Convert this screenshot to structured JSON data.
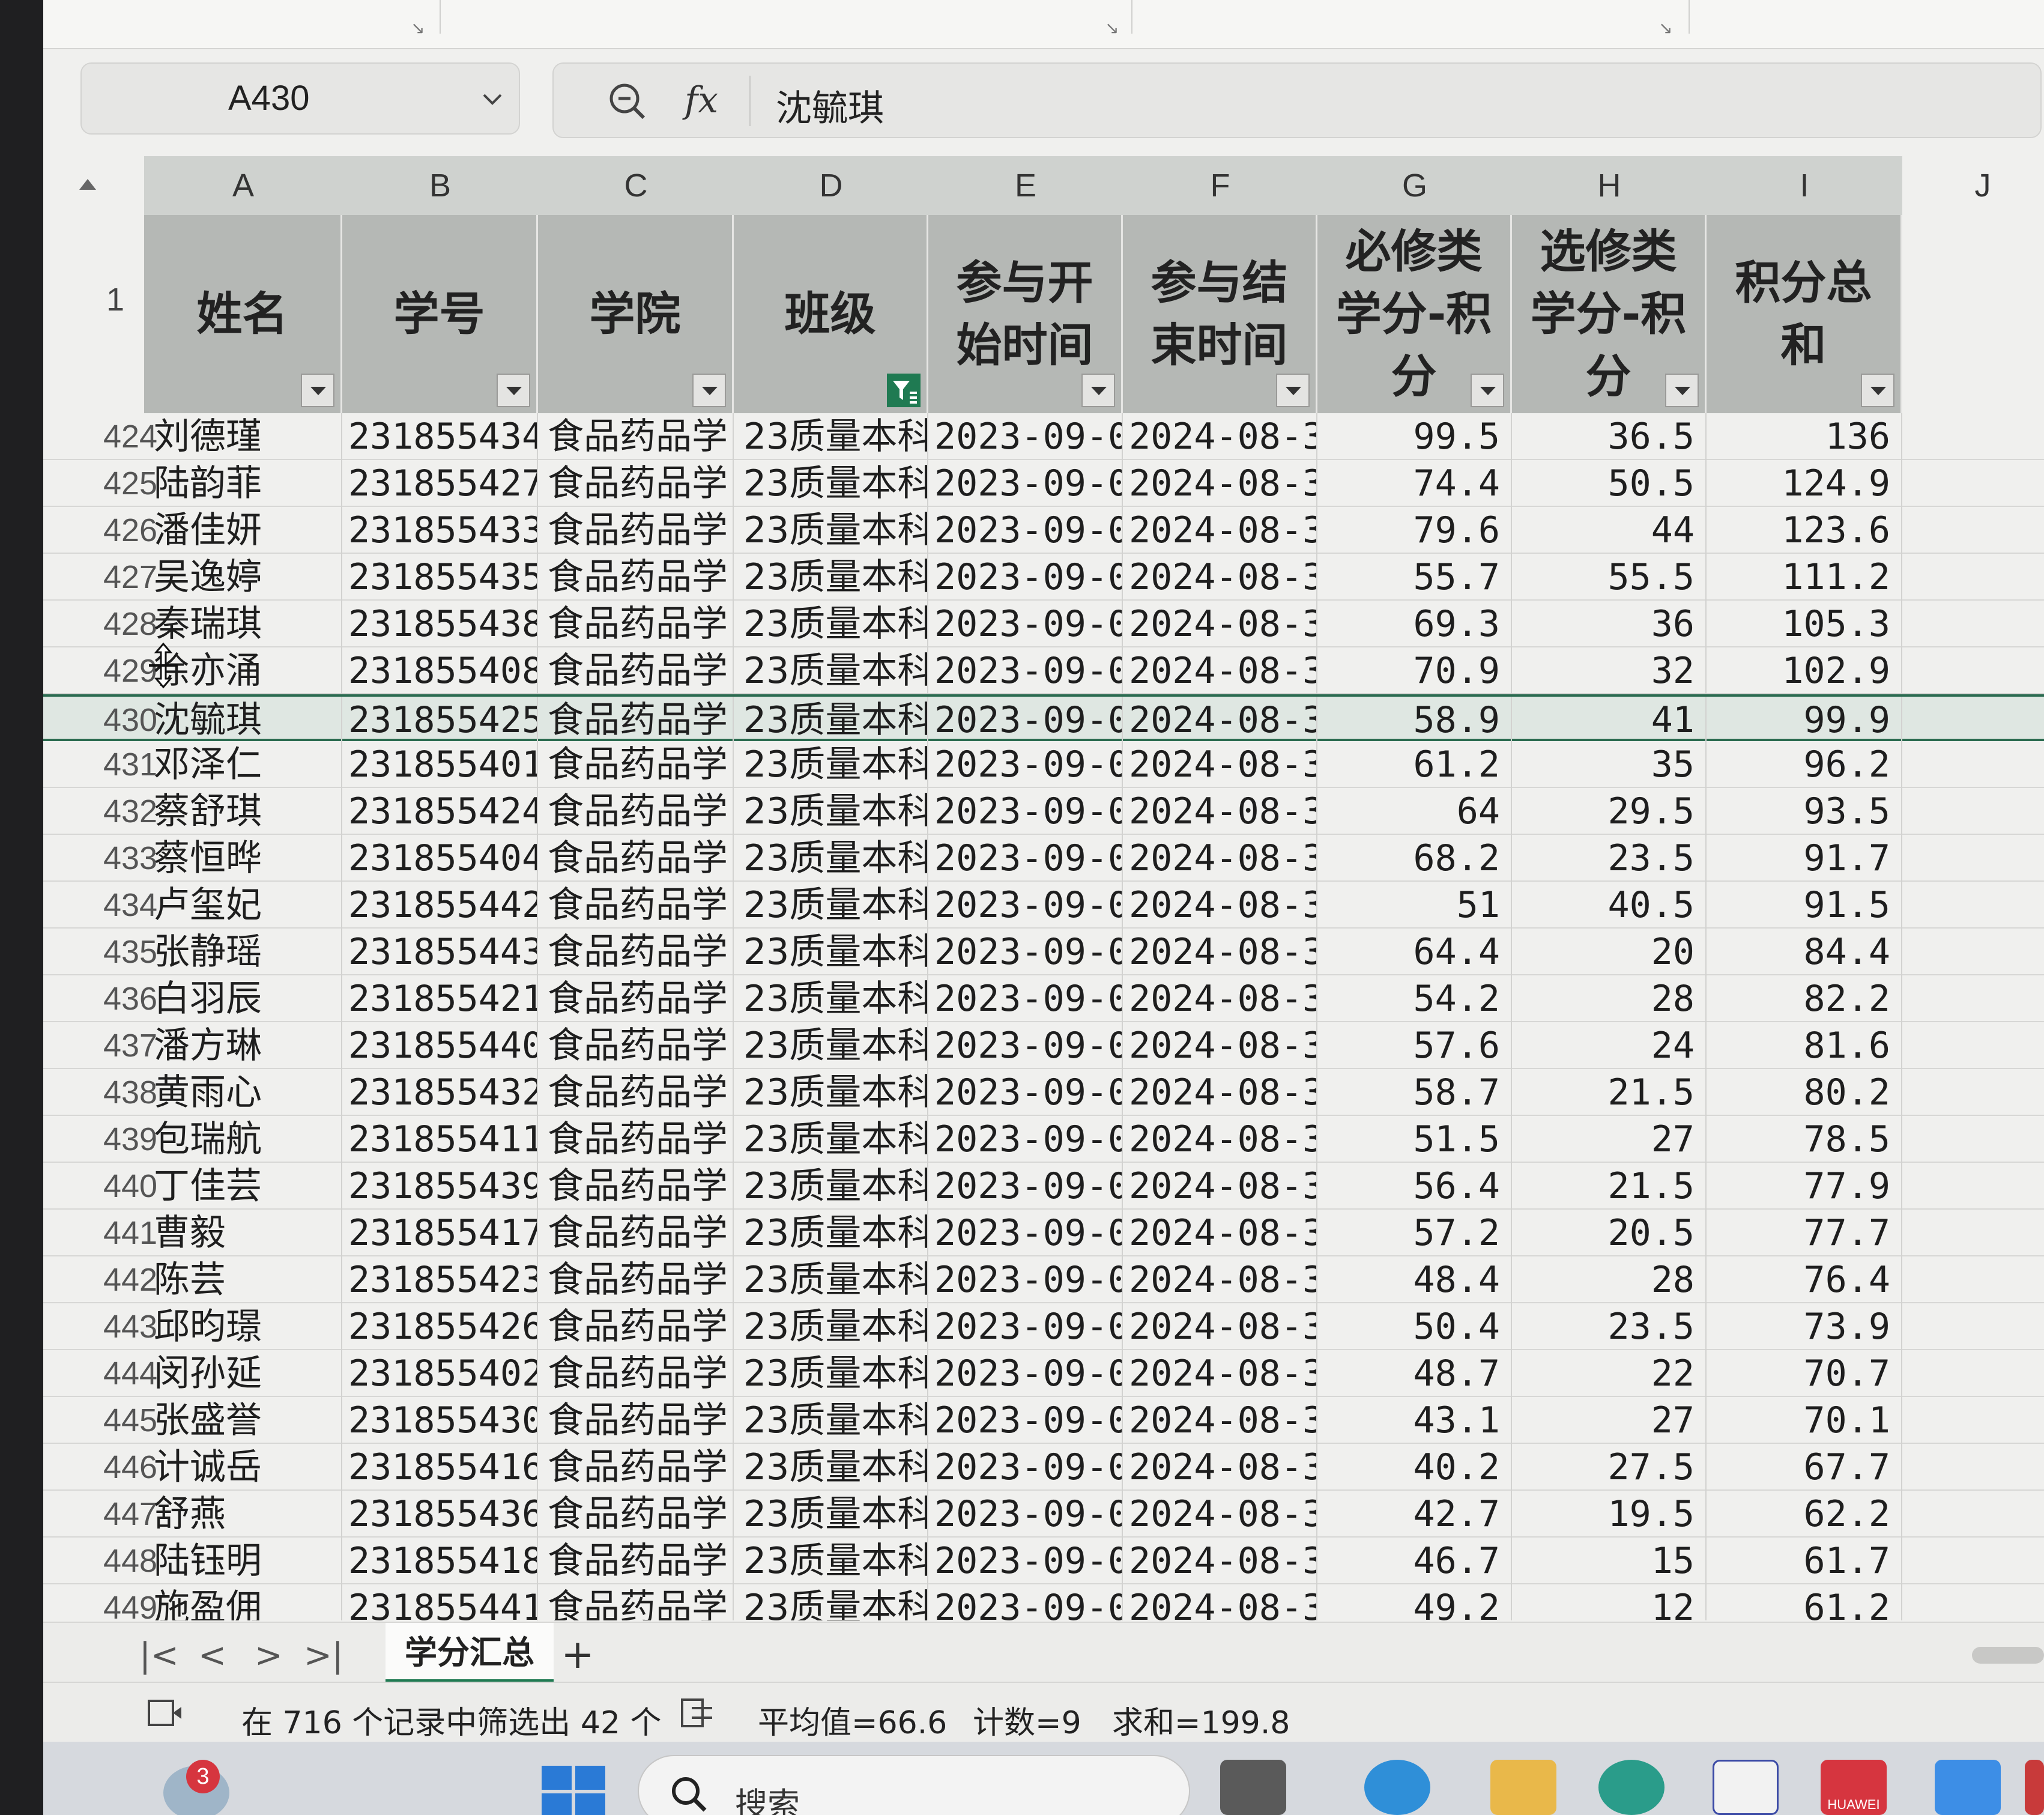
{
  "formula_bar": {
    "cell_ref": "A430",
    "fx_label": "fx",
    "value": "沈毓琪"
  },
  "column_letters": [
    "A",
    "B",
    "C",
    "D",
    "E",
    "F",
    "G",
    "H",
    "I",
    "J"
  ],
  "header_row": {
    "row_number": "1",
    "headers": [
      {
        "lines": [
          "姓名"
        ],
        "filter": "dropdown"
      },
      {
        "lines": [
          "学号"
        ],
        "filter": "dropdown"
      },
      {
        "lines": [
          "学院"
        ],
        "filter": "dropdown"
      },
      {
        "lines": [
          "班级"
        ],
        "filter": "active"
      },
      {
        "lines": [
          "参与开",
          "始时间"
        ],
        "filter": "dropdown"
      },
      {
        "lines": [
          "参与结",
          "束时间"
        ],
        "filter": "dropdown"
      },
      {
        "lines": [
          "必修类",
          "学分-积",
          "分"
        ],
        "filter": "dropdown"
      },
      {
        "lines": [
          "选修类",
          "学分-积",
          "分"
        ],
        "filter": "dropdown"
      },
      {
        "lines": [
          "积分总",
          "和"
        ],
        "filter": "dropdown"
      }
    ]
  },
  "rows": [
    {
      "n": "424",
      "name": "刘德瑾",
      "id": "231855434",
      "college": "食品药品学",
      "class": "23质量本科",
      "start": "2023-09-0",
      "end": "2024-08-3",
      "g": "99.5",
      "h": "36.5",
      "i": "136"
    },
    {
      "n": "425",
      "name": "陆韵菲",
      "id": "231855427",
      "college": "食品药品学",
      "class": "23质量本科",
      "start": "2023-09-0",
      "end": "2024-08-3",
      "g": "74.4",
      "h": "50.5",
      "i": "124.9"
    },
    {
      "n": "426",
      "name": "潘佳妍",
      "id": "231855433",
      "college": "食品药品学",
      "class": "23质量本科",
      "start": "2023-09-0",
      "end": "2024-08-3",
      "g": "79.6",
      "h": "44",
      "i": "123.6"
    },
    {
      "n": "427",
      "name": "吴逸婷",
      "id": "231855435",
      "college": "食品药品学",
      "class": "23质量本科",
      "start": "2023-09-0",
      "end": "2024-08-3",
      "g": "55.7",
      "h": "55.5",
      "i": "111.2"
    },
    {
      "n": "428",
      "name": "秦瑞琪",
      "id": "231855438",
      "college": "食品药品学",
      "class": "23质量本科",
      "start": "2023-09-0",
      "end": "2024-08-3",
      "g": "69.3",
      "h": "36",
      "i": "105.3"
    },
    {
      "n": "429",
      "name": "徐亦涌",
      "id": "231855408",
      "college": "食品药品学",
      "class": "23质量本科",
      "start": "2023-09-0",
      "end": "2024-08-3",
      "g": "70.9",
      "h": "32",
      "i": "102.9"
    },
    {
      "n": "430",
      "name": "沈毓琪",
      "id": "231855425",
      "college": "食品药品学",
      "class": "23质量本科",
      "start": "2023-09-0",
      "end": "2024-08-3",
      "g": "58.9",
      "h": "41",
      "i": "99.9",
      "selected": true
    },
    {
      "n": "431",
      "name": "邓泽仁",
      "id": "231855401",
      "college": "食品药品学",
      "class": "23质量本科",
      "start": "2023-09-0",
      "end": "2024-08-3",
      "g": "61.2",
      "h": "35",
      "i": "96.2"
    },
    {
      "n": "432",
      "name": "蔡舒琪",
      "id": "231855424",
      "college": "食品药品学",
      "class": "23质量本科",
      "start": "2023-09-0",
      "end": "2024-08-3",
      "g": "64",
      "h": "29.5",
      "i": "93.5"
    },
    {
      "n": "433",
      "name": "蔡恒晔",
      "id": "231855404",
      "college": "食品药品学",
      "class": "23质量本科",
      "start": "2023-09-0",
      "end": "2024-08-3",
      "g": "68.2",
      "h": "23.5",
      "i": "91.7"
    },
    {
      "n": "434",
      "name": "卢玺妃",
      "id": "231855442",
      "college": "食品药品学",
      "class": "23质量本科",
      "start": "2023-09-0",
      "end": "2024-08-3",
      "g": "51",
      "h": "40.5",
      "i": "91.5"
    },
    {
      "n": "435",
      "name": "张静瑶",
      "id": "231855443",
      "college": "食品药品学",
      "class": "23质量本科",
      "start": "2023-09-0",
      "end": "2024-08-3",
      "g": "64.4",
      "h": "20",
      "i": "84.4"
    },
    {
      "n": "436",
      "name": "白羽辰",
      "id": "231855421",
      "college": "食品药品学",
      "class": "23质量本科",
      "start": "2023-09-0",
      "end": "2024-08-3",
      "g": "54.2",
      "h": "28",
      "i": "82.2"
    },
    {
      "n": "437",
      "name": "潘方琳",
      "id": "231855440",
      "college": "食品药品学",
      "class": "23质量本科",
      "start": "2023-09-0",
      "end": "2024-08-3",
      "g": "57.6",
      "h": "24",
      "i": "81.6"
    },
    {
      "n": "438",
      "name": "黄雨心",
      "id": "231855432",
      "college": "食品药品学",
      "class": "23质量本科",
      "start": "2023-09-0",
      "end": "2024-08-3",
      "g": "58.7",
      "h": "21.5",
      "i": "80.2"
    },
    {
      "n": "439",
      "name": "包瑞航",
      "id": "231855411",
      "college": "食品药品学",
      "class": "23质量本科",
      "start": "2023-09-0",
      "end": "2024-08-3",
      "g": "51.5",
      "h": "27",
      "i": "78.5"
    },
    {
      "n": "440",
      "name": "丁佳芸",
      "id": "231855439",
      "college": "食品药品学",
      "class": "23质量本科",
      "start": "2023-09-0",
      "end": "2024-08-3",
      "g": "56.4",
      "h": "21.5",
      "i": "77.9"
    },
    {
      "n": "441",
      "name": "曹毅",
      "id": "231855417",
      "college": "食品药品学",
      "class": "23质量本科",
      "start": "2023-09-0",
      "end": "2024-08-3",
      "g": "57.2",
      "h": "20.5",
      "i": "77.7"
    },
    {
      "n": "442",
      "name": "陈芸",
      "id": "231855423",
      "college": "食品药品学",
      "class": "23质量本科",
      "start": "2023-09-0",
      "end": "2024-08-3",
      "g": "48.4",
      "h": "28",
      "i": "76.4"
    },
    {
      "n": "443",
      "name": "邱昀璟",
      "id": "231855426",
      "college": "食品药品学",
      "class": "23质量本科",
      "start": "2023-09-0",
      "end": "2024-08-3",
      "g": "50.4",
      "h": "23.5",
      "i": "73.9"
    },
    {
      "n": "444",
      "name": "闵孙延",
      "id": "231855402",
      "college": "食品药品学",
      "class": "23质量本科",
      "start": "2023-09-0",
      "end": "2024-08-3",
      "g": "48.7",
      "h": "22",
      "i": "70.7"
    },
    {
      "n": "445",
      "name": "张盛誉",
      "id": "231855430",
      "college": "食品药品学",
      "class": "23质量本科",
      "start": "2023-09-0",
      "end": "2024-08-3",
      "g": "43.1",
      "h": "27",
      "i": "70.1"
    },
    {
      "n": "446",
      "name": "计诚岳",
      "id": "231855416",
      "college": "食品药品学",
      "class": "23质量本科",
      "start": "2023-09-0",
      "end": "2024-08-3",
      "g": "40.2",
      "h": "27.5",
      "i": "67.7"
    },
    {
      "n": "447",
      "name": "舒燕",
      "id": "231855436",
      "college": "食品药品学",
      "class": "23质量本科",
      "start": "2023-09-0",
      "end": "2024-08-3",
      "g": "42.7",
      "h": "19.5",
      "i": "62.2"
    },
    {
      "n": "448",
      "name": "陆钰明",
      "id": "231855418",
      "college": "食品药品学",
      "class": "23质量本科",
      "start": "2023-09-0",
      "end": "2024-08-3",
      "g": "46.7",
      "h": "15",
      "i": "61.7"
    },
    {
      "n": "449",
      "name": "施盈佣",
      "id": "231855441",
      "college": "食品药品学",
      "class": "23质量本科",
      "start": "2023-09-0",
      "end": "2024-08-3",
      "g": "49.2",
      "h": "12",
      "i": "61.2"
    }
  ],
  "sheet_tabs": {
    "nav": [
      "|<",
      "<",
      ">",
      ">|"
    ],
    "active_tab": "学分汇总",
    "add": "+"
  },
  "status_bar": {
    "filter_info": "在 716 个记录中筛选出 42 个",
    "average": "平均值=66.6",
    "count": "计数=9",
    "sum": "求和=199.8"
  },
  "taskbar": {
    "search_placeholder": "搜索",
    "notification_count": "3",
    "huawei_label": "HUAWEI"
  },
  "colors": {
    "header_bg": "#b5b8b5",
    "filter_active": "#1f7a52",
    "selected_row_border": "#2b6b50",
    "badge": "#d6353f"
  }
}
